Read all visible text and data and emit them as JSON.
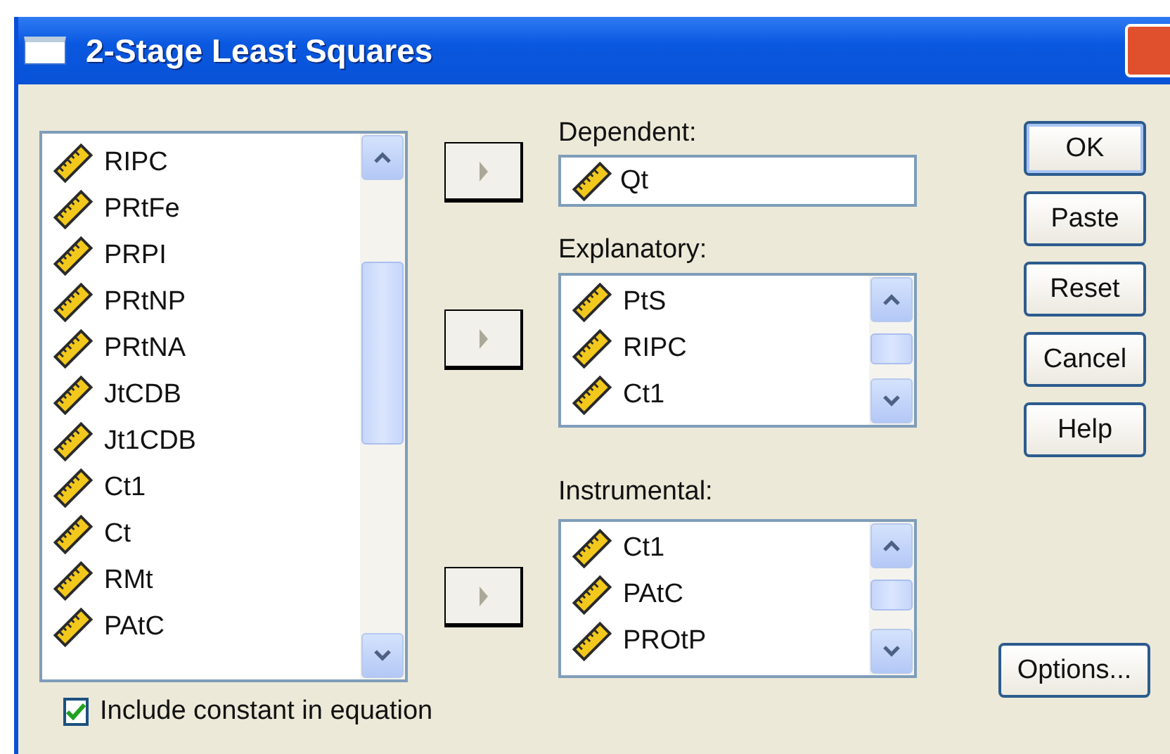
{
  "window": {
    "title": "2-Stage Least Squares"
  },
  "variables": {
    "items": [
      "RIPC",
      "PRtFe",
      "PRPI",
      "PRtNP",
      "PRtNA",
      "JtCDB",
      "Jt1CDB",
      "Ct1",
      "Ct",
      "RMt",
      "PAtC"
    ]
  },
  "dependent": {
    "label": "Dependent:",
    "value": "Qt"
  },
  "explanatory": {
    "label": "Explanatory:",
    "items": [
      "PtS",
      "RIPC",
      "Ct1"
    ]
  },
  "instrumental": {
    "label": "Instrumental:",
    "items": [
      "Ct1",
      "PAtC",
      "PROtP"
    ]
  },
  "buttons": [
    "OK",
    "Paste",
    "Reset",
    "Cancel",
    "Help"
  ],
  "options_button": "Options...",
  "include_constant": {
    "label": "Include constant in equation",
    "checked": true
  }
}
